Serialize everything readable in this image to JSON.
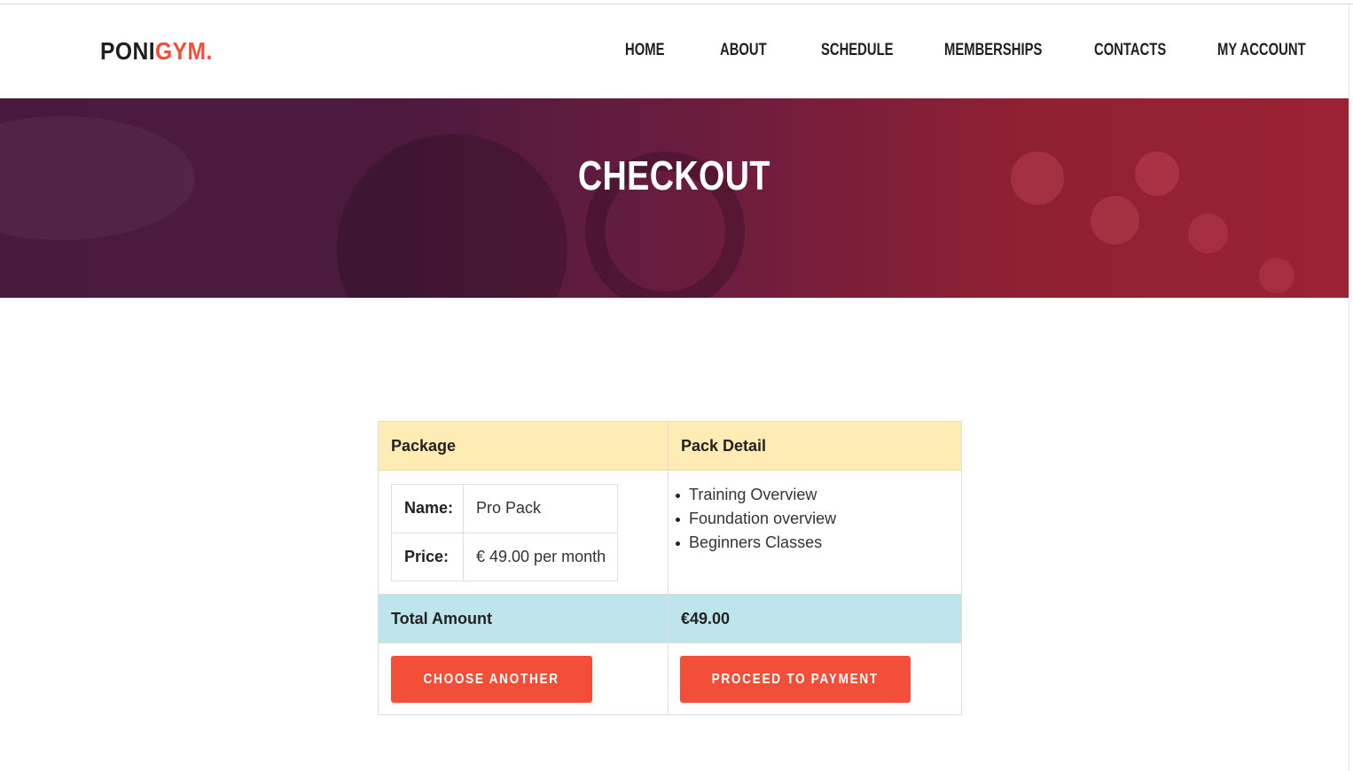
{
  "brand": {
    "part1": "PONI",
    "part2": "GYM.",
    "accent_color": "#f24e38"
  },
  "nav": {
    "items": [
      {
        "label": "HOME"
      },
      {
        "label": "ABOUT"
      },
      {
        "label": "SCHEDULE"
      },
      {
        "label": "MEMBERSHIPS"
      },
      {
        "label": "CONTACTS"
      },
      {
        "label": "MY ACCOUNT"
      }
    ]
  },
  "hero": {
    "title": "CHECKOUT"
  },
  "checkout": {
    "headers": {
      "package": "Package",
      "pack_detail": "Pack Detail"
    },
    "package": {
      "name_label": "Name:",
      "name_value": "Pro Pack",
      "price_label": "Price:",
      "price_value": "€ 49.00 per month"
    },
    "details": [
      "Training Overview",
      "Foundation overview",
      "Beginners Classes"
    ],
    "total": {
      "label": "Total Amount",
      "value": "€49.00"
    },
    "actions": {
      "choose_another": "CHOOSE ANOTHER",
      "proceed": "PROCEED TO PAYMENT"
    }
  },
  "colors": {
    "header_row": "#ffecb5",
    "total_row": "#bee5eb",
    "button": "#f24e38",
    "hero_left": "#4a1a3e",
    "hero_right": "#9a2234"
  }
}
